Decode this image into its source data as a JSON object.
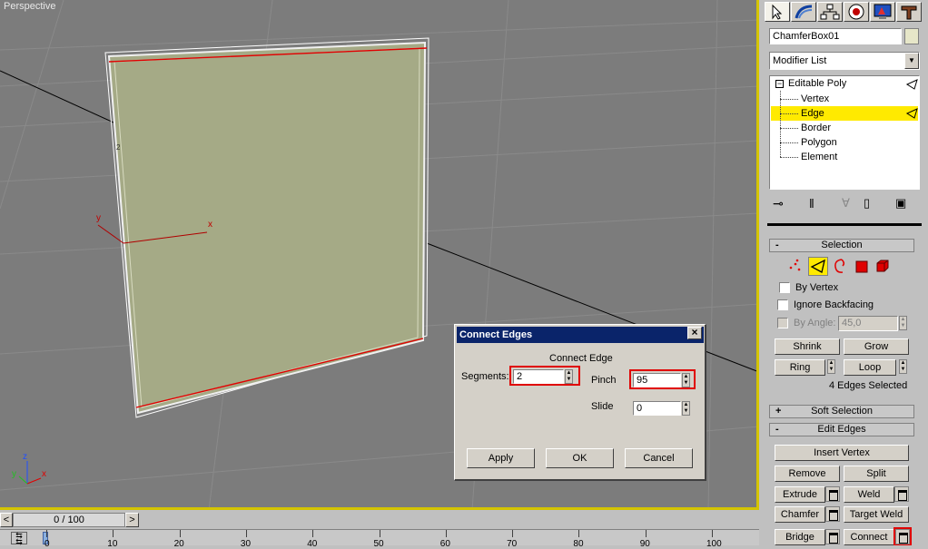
{
  "viewport": {
    "label": "Perspective",
    "edge_number": "2"
  },
  "axes": {
    "local_x": "x",
    "local_y": "y",
    "world_x": "x",
    "world_y": "y",
    "world_z": "z"
  },
  "command_panel": {
    "object_name": "ChamferBox01",
    "modifier_list": "Modifier List",
    "stack": {
      "root": "Editable Poly",
      "items": [
        "Vertex",
        "Edge",
        "Border",
        "Polygon",
        "Element"
      ],
      "selected": "Edge"
    },
    "selection": {
      "title": "Selection",
      "by_vertex": "By Vertex",
      "ignore_backfacing": "Ignore Backfacing",
      "by_angle": "By Angle:",
      "angle_value": "45,0",
      "shrink": "Shrink",
      "grow": "Grow",
      "ring": "Ring",
      "loop": "Loop",
      "status": "4 Edges Selected"
    },
    "soft_selection": {
      "title": "Soft Selection",
      "sign": "+"
    },
    "edit_edges": {
      "title": "Edit Edges",
      "sign": "-",
      "insert_vertex": "Insert Vertex",
      "remove": "Remove",
      "split": "Split",
      "extrude": "Extrude",
      "weld": "Weld",
      "chamfer": "Chamfer",
      "target_weld": "Target Weld",
      "bridge": "Bridge",
      "connect": "Connect"
    },
    "selection_sign": "-"
  },
  "dialog": {
    "title": "Connect Edges",
    "group": "Connect Edge",
    "segments_label": "Segments:",
    "segments_value": "2",
    "pinch_label": "Pinch",
    "pinch_value": "95",
    "slide_label": "Slide",
    "slide_value": "0",
    "apply": "Apply",
    "ok": "OK",
    "cancel": "Cancel",
    "close": "×"
  },
  "timeline": {
    "frame": "0 / 100",
    "prev": "<",
    "next": ">",
    "ticks": [
      "0",
      "10",
      "20",
      "30",
      "40",
      "50",
      "60",
      "70",
      "80",
      "90",
      "100"
    ]
  },
  "colors": {
    "plane_fill": "#a5aa86",
    "selection_red": "#e00000",
    "highlight": "#ffea00",
    "title_bar": "#0a246a"
  }
}
